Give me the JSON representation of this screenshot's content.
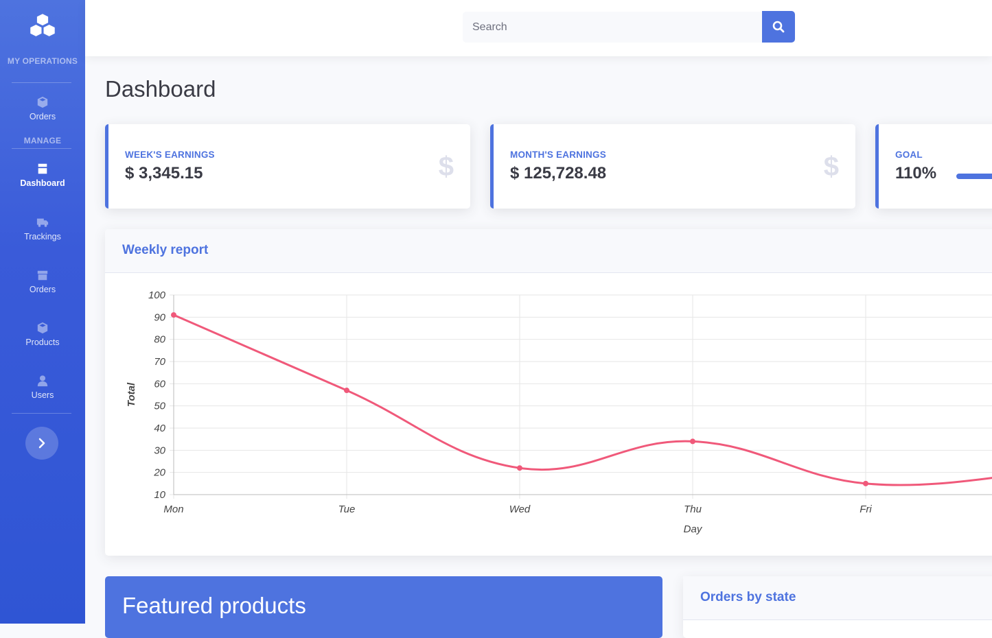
{
  "sidebar": {
    "brand_icon": "cubes-icon",
    "headings": [
      "My Operations",
      "Manage"
    ],
    "items": [
      {
        "label": "Orders",
        "icon": "cube-icon"
      },
      {
        "label": "Dashboard",
        "icon": "dashboard-icon",
        "active": true
      },
      {
        "label": "Trackings",
        "icon": "truck-icon"
      },
      {
        "label": "Orders",
        "icon": "box-icon"
      },
      {
        "label": "Products",
        "icon": "cube-icon"
      },
      {
        "label": "Users",
        "icon": "user-icon"
      }
    ],
    "toggle_icon": "chevron-right-icon"
  },
  "topbar": {
    "search_placeholder": "Search",
    "search_icon": "search-icon"
  },
  "page": {
    "title": "Dashboard"
  },
  "cards": [
    {
      "label": "Week's Earnings",
      "value": "$ 3,345.15",
      "icon": "$"
    },
    {
      "label": "Month's Earnings",
      "value": "$ 125,728.48",
      "icon": "$"
    },
    {
      "label": "Goal",
      "value": "110%",
      "progress_percent": 110
    }
  ],
  "weekly_report": {
    "title": "Weekly report"
  },
  "chart_data": {
    "type": "line",
    "title": "",
    "xlabel": "Day",
    "ylabel": "Total",
    "categories": [
      "Mon",
      "Tue",
      "Wed",
      "Thu",
      "Fri"
    ],
    "series": [
      {
        "values": [
          91,
          57,
          22,
          34,
          15
        ],
        "color": "#f0597a"
      }
    ],
    "ylim": [
      10,
      100
    ],
    "yticks": [
      10,
      20,
      30,
      40,
      50,
      60,
      70,
      80,
      90,
      100
    ],
    "grid": true
  },
  "featured": {
    "title": "Featured products"
  },
  "orders_by_state": {
    "title": "Orders by state"
  },
  "colors": {
    "primary": "#4e73df",
    "line": "#f0597a",
    "text_dark": "#3a3b45"
  }
}
